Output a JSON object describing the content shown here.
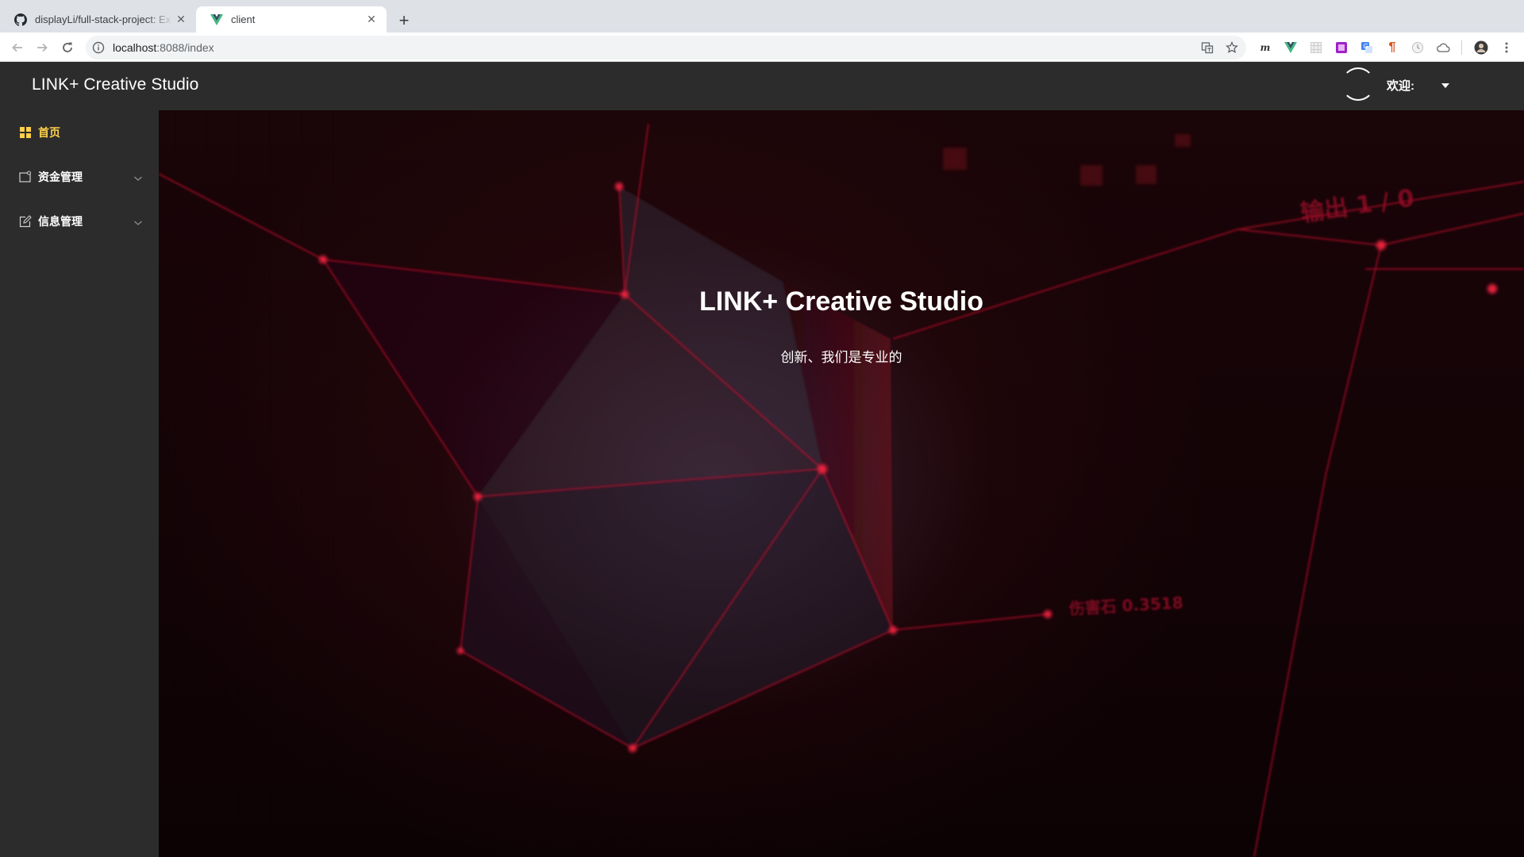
{
  "browser": {
    "tabs": [
      {
        "title": "displayLi/full-stack-project: Ex",
        "favicon": "github-icon",
        "active": false
      },
      {
        "title": "client",
        "favicon": "vue-icon",
        "active": true
      }
    ],
    "address": {
      "host": "localhost",
      "rest": ":8088/index"
    }
  },
  "app": {
    "brand": "LINK+ Creative Studio",
    "welcome": "欢迎:",
    "accent_color": "#ffd04b",
    "sidebar": {
      "items": [
        {
          "label": "首页",
          "icon": "grid-icon",
          "active": true
        },
        {
          "label": "资金管理",
          "icon": "folder-icon",
          "expandable": true
        },
        {
          "label": "信息管理",
          "icon": "edit-icon",
          "expandable": true
        }
      ]
    },
    "hero": {
      "title": "LINK+ Creative Studio",
      "subtitle": "创新、我们是专业的",
      "bg_text_1": "输出 1 / 0",
      "bg_text_2": "伤害石 0.3518"
    }
  }
}
